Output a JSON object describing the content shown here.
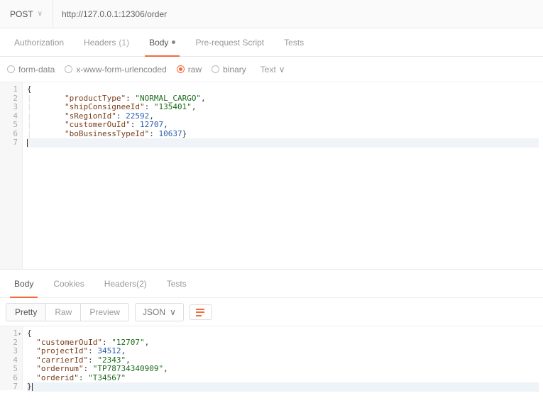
{
  "request": {
    "method": "POST",
    "url": "http://127.0.0.1:12306/order",
    "tabs": {
      "authorization": "Authorization",
      "headers": "Headers",
      "headers_count": "(1)",
      "body": "Body",
      "prerequest": "Pre-request Script",
      "tests": "Tests"
    },
    "body_types": {
      "formdata": "form-data",
      "urlencoded": "x-www-form-urlencoded",
      "raw": "raw",
      "binary": "binary"
    },
    "raw_format": "Text",
    "body_lines": [
      "{",
      "        \"productType\":\"NORMAL_CARGO\",",
      "        \"shipConsigneeId\":\"135401\",",
      "        \"sRegionId\":22592,",
      "        \"customerOuId\":12707,",
      "        \"boBusinessTypeId\":10637}",
      ""
    ]
  },
  "response": {
    "tabs": {
      "body": "Body",
      "cookies": "Cookies",
      "headers": "Headers",
      "headers_count": "(2)",
      "tests": "Tests"
    },
    "views": {
      "pretty": "Pretty",
      "raw": "Raw",
      "preview": "Preview"
    },
    "format": "JSON",
    "body_lines": [
      "{",
      "  \"customerOuId\": \"12707\",",
      "  \"projectId\": 34512,",
      "  \"carrierId\": \"2343\",",
      "  \"ordernum\": \"TP78734340909\",",
      "  \"orderid\": \"T34567\"",
      "}"
    ]
  }
}
